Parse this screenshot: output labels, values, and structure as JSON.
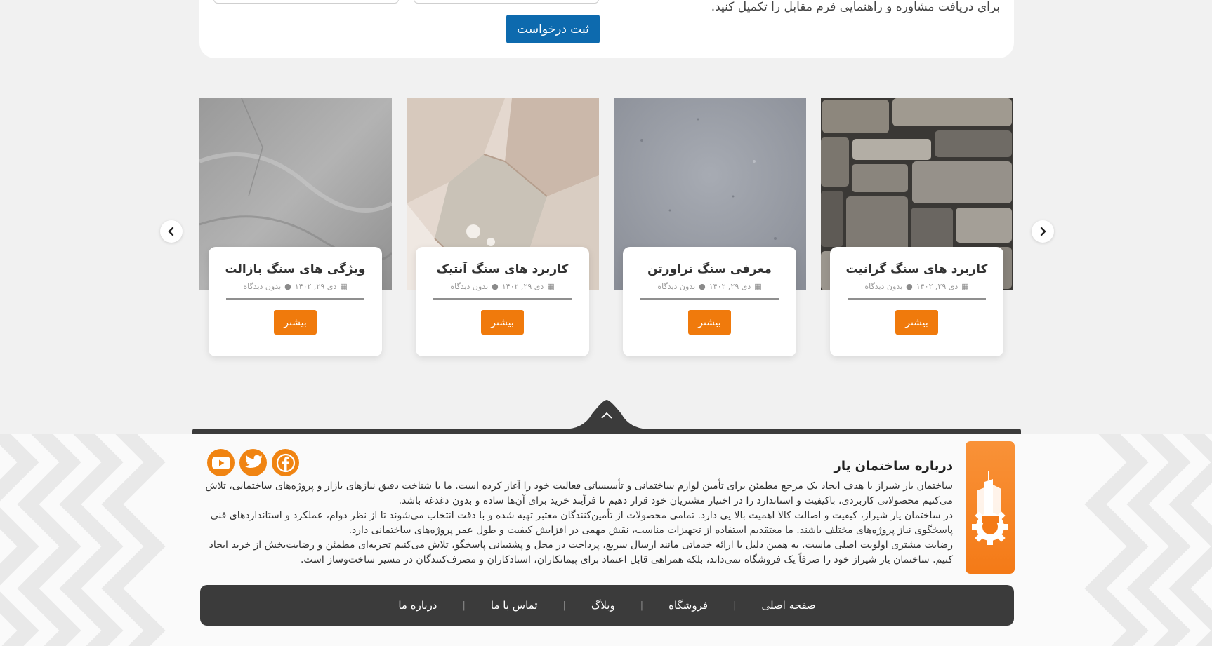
{
  "form": {
    "intro_text": "برای دریافت مشاوره و راهنمایی فرم مقابل را تکمیل کنید.",
    "submit_label": "ثبت درخواست"
  },
  "carousel": {
    "items": [
      {
        "title": "کاربرد های سنگ گرانیت",
        "date": "دی ۲۹, ۱۴۰۲",
        "comments": "بدون دیدگاه",
        "button": "بیشتر"
      },
      {
        "title": "معرفی سنگ تراورتن",
        "date": "دی ۲۹, ۱۴۰۲",
        "comments": "بدون دیدگاه",
        "button": "بیشتر"
      },
      {
        "title": "کاربرد های سنگ آنتیک",
        "date": "دی ۲۹, ۱۴۰۲",
        "comments": "بدون دیدگاه",
        "button": "بیشتر"
      },
      {
        "title": "ویژگی های سنگ بازالت",
        "date": "دی ۲۹, ۱۴۰۲",
        "comments": "بدون دیدگاه",
        "button": "بیشتر"
      }
    ]
  },
  "footer": {
    "about_title": "درباره ساختمان یار",
    "paragraphs": [
      "ساختمان یار شیراز با هدف ایجاد یک مرجع مطمئن برای تأمین لوازم ساختمانی و تأسیساتی فعالیت خود را آغاز کرده است. ما با شناخت دقیق نیازهای بازار و پروژه‌های ساختمانی، تلاش می‌کنیم محصولاتی کاربردی، باکیفیت و استاندارد را در اختیار مشتریان خود قرار دهیم تا فرآیند خرید برای آن‌ها ساده و بدون دغدغه باشد.",
      "در ساختمان یار شیراز، کیفیت و اصالت کالا اهمیت بالا یی دارد. تمامی محصولات از تأمین‌کنندگان معتبر تهیه شده و با دقت انتخاب می‌شوند تا از نظر دوام، عملکرد و استانداردهای فنی پاسخگوی نیاز پروژه‌های مختلف باشند. ما معتقدیم استفاده از تجهیزات مناسب، نقش مهمی در افزایش کیفیت و طول عمر پروژه‌های ساختمانی دارد.",
      "رضایت مشتری اولویت اصلی ماست. به همین دلیل با ارائه خدماتی مانند ارسال سریع، پرداخت در محل و پشتیبانی پاسخگو، تلاش می‌کنیم تجربه‌ای مطمئن و رضایت‌بخش از خرید ایجاد کنیم. ساختمان یار شیراز خود را صرفاً یک فروشگاه نمی‌داند، بلکه همراهی قابل اعتماد برای پیمانکاران، استادکاران و مصرف‌کنندگان در مسیر ساخت‌وساز است."
    ],
    "menu": [
      "صفحه اصلی",
      "فروشگاه",
      "وبلاگ",
      "تماس با ما",
      "درباره ما"
    ],
    "menu_separator": "|",
    "social": [
      "facebook-icon",
      "twitter-icon",
      "youtube-icon"
    ],
    "accent_color": "#f47a17",
    "dark_color": "#3b3b3b"
  }
}
